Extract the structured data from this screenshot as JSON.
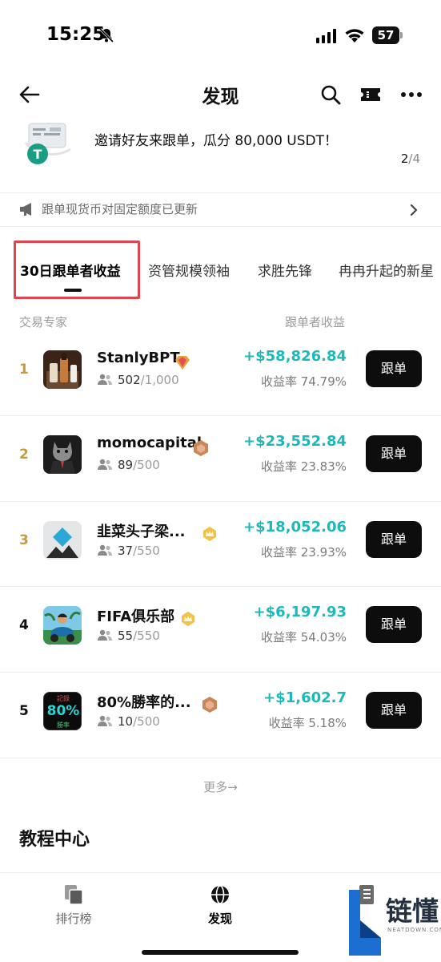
{
  "status_bar": {
    "time": "15:25",
    "battery": "57"
  },
  "nav": {
    "title": "发现"
  },
  "banner": {
    "text": "邀请好友来跟单，瓜分 80,000 USDT！",
    "page_current": "2",
    "page_sep": "/",
    "page_total": "4"
  },
  "notice": {
    "text": "跟单现货币对固定额度已更新"
  },
  "tabs": [
    {
      "label": "30日跟单者收益",
      "active": true
    },
    {
      "label": "资管规模领袖",
      "active": false
    },
    {
      "label": "求胜先锋",
      "active": false
    },
    {
      "label": "冉冉升起的新星",
      "active": false
    }
  ],
  "list_header": {
    "left": "交易专家",
    "right": "跟单者收益"
  },
  "traders": [
    {
      "rank": "1",
      "name": "StanlyBPT",
      "followers": "502",
      "capacity": "/1,000",
      "profit": "+$58,826.84",
      "rate": "收益率 74.79%",
      "button": "跟单",
      "rank_color": "#c79a3a",
      "badge": "red-diamond-badge-icon"
    },
    {
      "rank": "2",
      "name": "momocapital",
      "followers": "89",
      "capacity": "/500",
      "profit": "+$23,552.84",
      "rate": "收益率 23.83%",
      "button": "跟单",
      "rank_color": "#c79a3a",
      "badge": "bronze-badge-icon"
    },
    {
      "rank": "3",
      "name": "韭菜头子梁...",
      "followers": "37",
      "capacity": "/550",
      "profit": "+$18,052.06",
      "rate": "收益率 23.93%",
      "button": "跟单",
      "rank_color": "#c79a3a",
      "badge": "gold-crown-badge-icon"
    },
    {
      "rank": "4",
      "name": "FIFA俱乐部",
      "followers": "55",
      "capacity": "/550",
      "profit": "+$6,197.93",
      "rate": "收益率 54.03%",
      "button": "跟单",
      "rank_color": "#111111",
      "badge": "gold-crown-badge-icon"
    },
    {
      "rank": "5",
      "name": "80%勝率的...",
      "followers": "10",
      "capacity": "/500",
      "profit": "+$1,602.7",
      "rate": "收益率 5.18%",
      "button": "跟单",
      "rank_color": "#111111",
      "badge": "bronze-badge-icon"
    }
  ],
  "avatar5": {
    "top": "記錄",
    "main": "80%",
    "bottom": "勝率"
  },
  "more_link": "更多→",
  "section": {
    "title": "教程中心"
  },
  "bottom_nav": [
    {
      "label": "排行榜",
      "icon": "copy-pages-icon"
    },
    {
      "label": "发现",
      "icon": "globe-icon"
    },
    {
      "label": "",
      "icon": "notebook-icon"
    }
  ],
  "watermark": {
    "text": "链懂",
    "sub": "NEATDOWN.COM"
  },
  "colors": {
    "profit": "#1fb8b8",
    "button_bg": "#0d0d0d",
    "highlight": "#e0444f",
    "rank_top": "#c79a3a"
  }
}
